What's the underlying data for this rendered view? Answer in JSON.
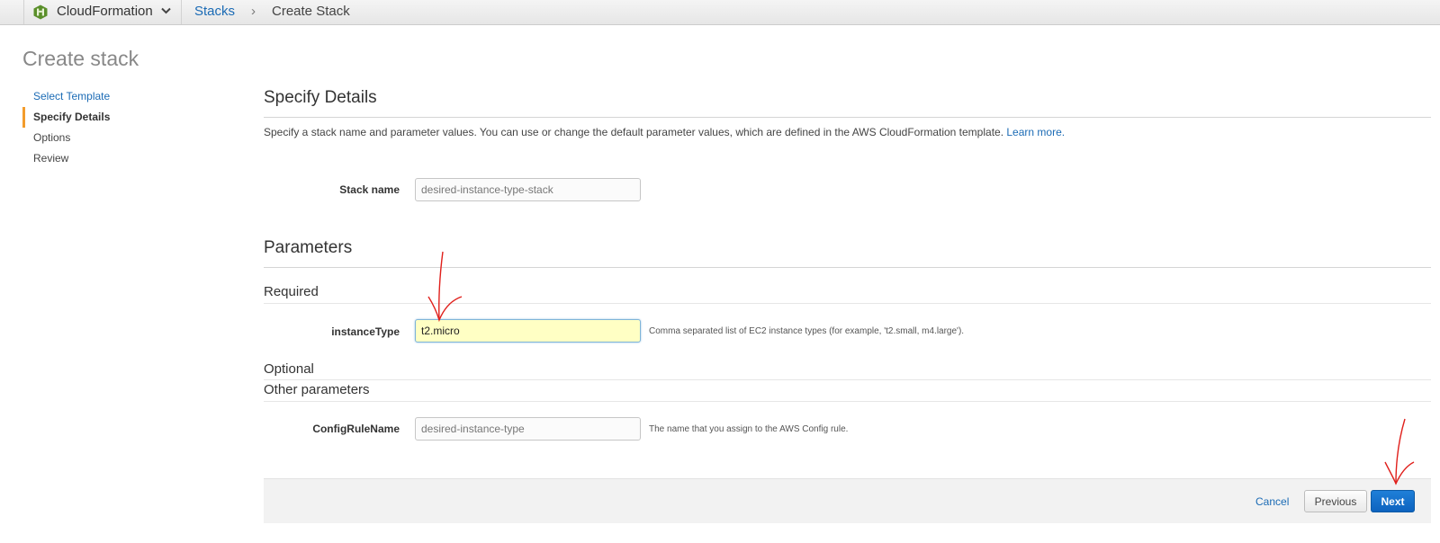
{
  "topbar": {
    "service_name": "CloudFormation",
    "breadcrumb_stacks": "Stacks",
    "breadcrumb_separator": "›",
    "breadcrumb_current": "Create Stack"
  },
  "page": {
    "title": "Create stack"
  },
  "steps": [
    {
      "label": "Select Template",
      "state": "link"
    },
    {
      "label": "Specify Details",
      "state": "active"
    },
    {
      "label": "Options",
      "state": "plain"
    },
    {
      "label": "Review",
      "state": "plain"
    }
  ],
  "details": {
    "title": "Specify Details",
    "description": "Specify a stack name and parameter values. You can use or change the default parameter values, which are defined in the AWS CloudFormation template.",
    "learn_more": "Learn more.",
    "stack_name_label": "Stack name",
    "stack_name_value": "desired-instance-type-stack"
  },
  "parameters": {
    "title": "Parameters",
    "required_title": "Required",
    "instance_type_label": "instanceType",
    "instance_type_value": "t2.micro",
    "instance_type_hint": "Comma separated list of EC2 instance types (for example, 't2.small, m4.large').",
    "optional_title": "Optional",
    "other_title": "Other parameters",
    "config_rule_label": "ConfigRuleName",
    "config_rule_value": "desired-instance-type",
    "config_rule_hint": "The name that you assign to the AWS Config rule."
  },
  "actions": {
    "cancel": "Cancel",
    "previous": "Previous",
    "next": "Next"
  },
  "colors": {
    "link": "#1b6bb5",
    "active_step_marker": "#f39c2c",
    "focused_input_bg": "#ffffc4",
    "primary_button": "#0d63bf",
    "annotation": "#e0201c"
  },
  "icons": {
    "logo": "cloudformation-logo-icon",
    "dropdown": "chevron-down-icon"
  }
}
